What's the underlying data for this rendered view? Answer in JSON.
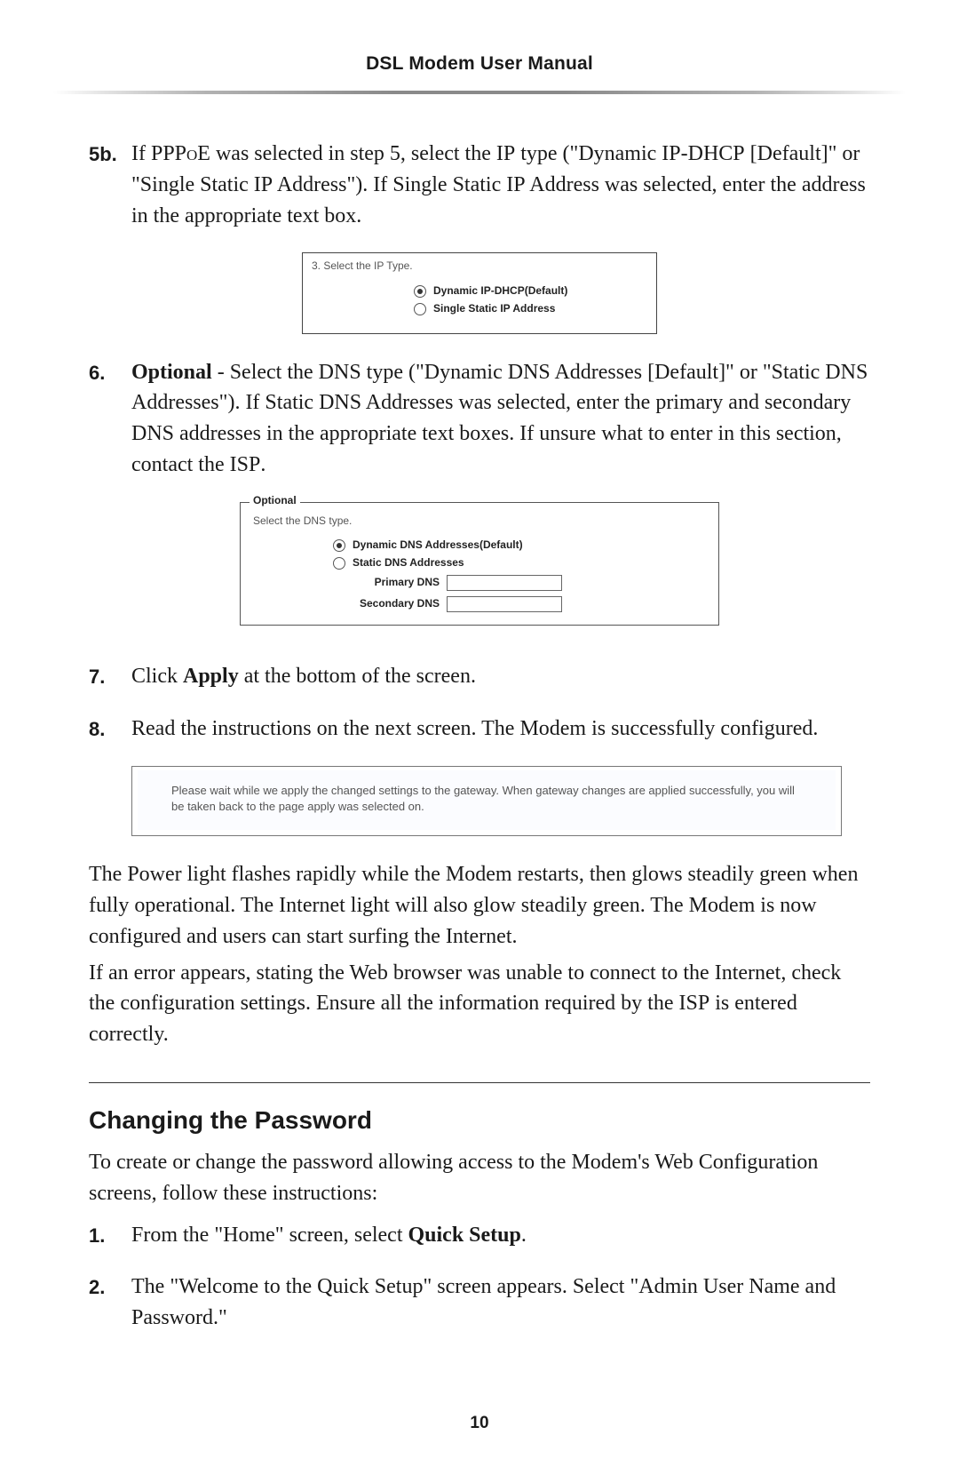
{
  "header": {
    "title": "DSL Modem User Manual"
  },
  "step5b": {
    "num": "5b.",
    "text_pre": "If ",
    "pppoe": "PPPoE",
    "text_mid1": " was selected in step 5,  select the ",
    "ip": "IP",
    "text_mid2": " type (\"Dynamic ",
    "ipdhcp": "IP-DHCP",
    "text_mid3": " [Default]\" or \"Single Static ",
    "ip2": "IP",
    "text_mid4": " Address\"). If Single Static ",
    "ip3": "IP",
    "text_end": " Address was selected, enter the address in the appropriate text box."
  },
  "fig_ip": {
    "title": "3. Select the IP Type.",
    "opt1": "Dynamic IP-DHCP(Default)",
    "opt2": "Single Static IP Address"
  },
  "step6": {
    "num": "6.",
    "bold": "Optional",
    "t1": " - Select the ",
    "dns": "DNS",
    "t2": " type (\"Dynamic ",
    "dns2": "DNS",
    "t3": " Addresses [Default]\" or \"Static ",
    "dns3": "DNS",
    "t4": " Addresses\"). If Static ",
    "dns4": "DNS",
    "t5": " Addresses was selected, enter the primary and secondary ",
    "dns5": "DNS",
    "t6": " addresses in the appropriate text boxes. If unsure what to enter in this section, contact the ",
    "isp": "ISP",
    "t7": "."
  },
  "fig_dns": {
    "legend": "Optional",
    "sub": "Select the DNS type.",
    "opt1": "Dynamic DNS Addresses(Default)",
    "opt2": "Static DNS Addresses",
    "primary_lbl": "Primary DNS",
    "secondary_lbl": "Secondary DNS"
  },
  "step7": {
    "num": "7.",
    "t1": "Click ",
    "apply": "Apply",
    "t2": " at the bottom of the screen."
  },
  "step8": {
    "num": "8.",
    "text": "Read the instructions on the next screen. The Modem is successfully configured."
  },
  "fig_wait": {
    "text": "Please wait while we apply the changed settings to the gateway. When gateway changes are applied successfully, you will be taken back to the page apply was selected on."
  },
  "para_power": "The Power light flashes rapidly while the Modem restarts, then glows steadily green when fully operational. The Internet light will also glow steadily green. The Modem is now configured and users can start surfing the Internet.",
  "para_error_1": "If an error appears, stating the Web browser was unable to connect to the Internet, check the configuration settings. Ensure all the information required by the ",
  "para_error_isp": "ISP",
  "para_error_2": " is entered correctly.",
  "section2": {
    "title": "Changing the Password",
    "intro": "To create or change the password allowing access to the Modem's Web Configuration screens, follow these instructions:"
  },
  "pw_step1": {
    "num": "1.",
    "t1": "From the \"Home\" screen, select ",
    "bold": "Quick Setup",
    "t2": "."
  },
  "pw_step2": {
    "num": "2.",
    "text": "The \"Welcome to the Quick Setup\" screen appears. Select \"Admin User Name and Password.\""
  },
  "page_number": "10"
}
